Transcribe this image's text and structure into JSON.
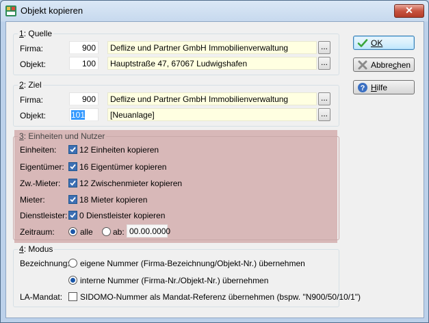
{
  "window": {
    "title": "Objekt kopieren",
    "close_glyph": "✕"
  },
  "quelle": {
    "legend_prefix": "1",
    "legend_suffix": ": Quelle",
    "firma_label": "Firma:",
    "firma_nr": "900",
    "firma_name": "Deflize und Partner GmbH Immobilienverwaltung",
    "objekt_label": "Objekt:",
    "objekt_nr": "100",
    "objekt_name": "Hauptstraße 47, 67067 Ludwigshafen"
  },
  "ziel": {
    "legend_prefix": "2",
    "legend_suffix": ": Ziel",
    "firma_label": "Firma:",
    "firma_nr": "900",
    "firma_name": "Deflize und Partner GmbH Immobilienverwaltung",
    "objekt_label": "Objekt:",
    "objekt_nr": "101",
    "objekt_name": "[Neuanlage]"
  },
  "einheiten": {
    "legend_prefix": "3",
    "legend_suffix": ": Einheiten und Nutzer",
    "rows": [
      {
        "label": "Einheiten:",
        "text": "12 Einheiten kopieren",
        "checked": true
      },
      {
        "label": "Eigentümer:",
        "text": "16 Eigentümer kopieren",
        "checked": true
      },
      {
        "label": "Zw.-Mieter:",
        "text": "12 Zwischenmieter kopieren",
        "checked": true
      },
      {
        "label": "Mieter:",
        "text": "18 Mieter kopieren",
        "checked": true
      },
      {
        "label": "Dienstleister:",
        "text": "0 Dienstleister kopieren",
        "checked": true
      }
    ],
    "zeitraum_label": "Zeitraum:",
    "alle_label": "alle",
    "ab_label": "ab:",
    "ab_value": "00.00.0000",
    "selected": "alle"
  },
  "modus": {
    "legend_prefix": "4",
    "legend_suffix": ": Modus",
    "bezeichnung_label": "Bezeichnung:",
    "option_eigene": "eigene Nummer (Firma-Bezeichnung/Objekt-Nr.) übernehmen",
    "option_interne": "interne Nummer (Firma-Nr./Objekt-Nr.) übernehmen",
    "selected": "interne",
    "lamandat_label": "LA-Mandat:",
    "lamandat_text": "SIDOMO-Nummer als Mandat-Referenz übernehmen (bspw. \"N900/50/10/1\")",
    "lamandat_checked": false
  },
  "buttons": {
    "ok": "OK",
    "abbrechen_a": "Abbre",
    "abbrechen_u": "c",
    "abbrechen_b": "hen",
    "hilfe_u": "H",
    "hilfe_b": "ilfe"
  },
  "dots_label": "...",
  "colors": {
    "accent": "#3d6fb3",
    "highlight_area": "#d8b8b8",
    "input_yellow": "#ffffe1"
  }
}
